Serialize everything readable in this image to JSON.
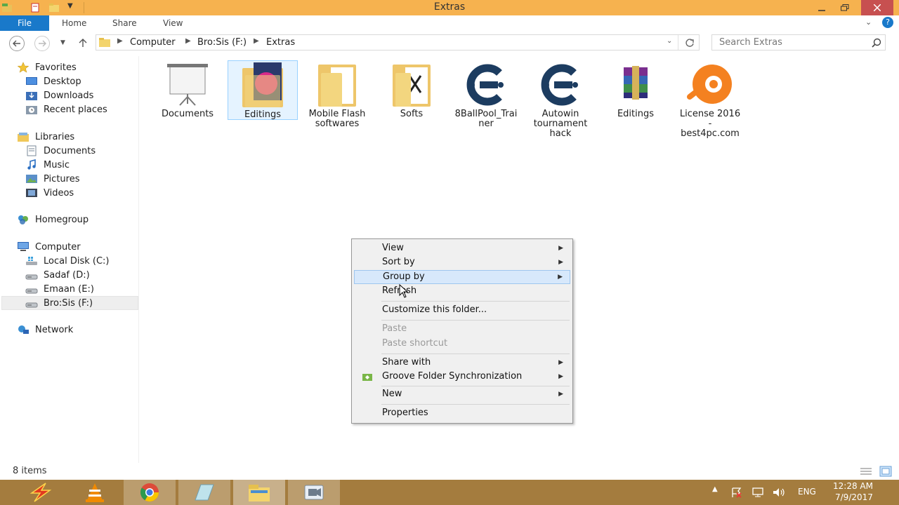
{
  "window": {
    "title": "Extras"
  },
  "ribbon": {
    "tabs": [
      "File",
      "Home",
      "Share",
      "View"
    ]
  },
  "address": {
    "crumbs": [
      "Computer",
      "Bro:Sis (F:)",
      "Extras"
    ]
  },
  "search": {
    "placeholder": "Search Extras"
  },
  "nav": {
    "favorites": {
      "label": "Favorites",
      "items": [
        "Desktop",
        "Downloads",
        "Recent places"
      ]
    },
    "libraries": {
      "label": "Libraries",
      "items": [
        "Documents",
        "Music",
        "Pictures",
        "Videos"
      ]
    },
    "homegroup": "Homegroup",
    "computer": {
      "label": "Computer",
      "items": [
        "Local Disk (C:)",
        "Sadaf (D:)",
        "Emaan (E:)",
        "Bro:Sis (F:)"
      ]
    },
    "network": "Network"
  },
  "files": [
    {
      "name": "Documents",
      "icon": "presentation-icon"
    },
    {
      "name": "Editings",
      "icon": "folder-icon",
      "selected": true
    },
    {
      "name": "Mobile Flash softwares",
      "icon": "folder-icon"
    },
    {
      "name": "Softs",
      "icon": "folder-icon"
    },
    {
      "name": "8BallPool_Trainer",
      "icon": "cheat-engine-icon"
    },
    {
      "name": "Autowin tournament hack",
      "icon": "cheat-engine-icon"
    },
    {
      "name": "Editings",
      "icon": "winrar-icon"
    },
    {
      "name": "License 2016 - best4pc.com",
      "icon": "avast-icon"
    }
  ],
  "context_menu": {
    "items": [
      {
        "label": "View",
        "submenu": true
      },
      {
        "label": "Sort by",
        "submenu": true
      },
      {
        "label": "Group by",
        "submenu": true,
        "highlighted": true
      },
      {
        "label": "Refresh"
      },
      {
        "label": "Customize this folder..."
      },
      {
        "label": "Paste",
        "disabled": true
      },
      {
        "label": "Paste shortcut",
        "disabled": true
      },
      {
        "label": "Share with",
        "submenu": true
      },
      {
        "label": "Groove Folder Synchronization",
        "submenu": true
      },
      {
        "label": "New",
        "submenu": true
      },
      {
        "label": "Properties"
      }
    ]
  },
  "status": {
    "item_count": "8 items"
  },
  "tray": {
    "language": "ENG",
    "time": "12:28 AM",
    "date": "7/9/2017"
  },
  "colors": {
    "titlebar": "#f6b24f",
    "taskbar": "#a47c3e",
    "file_tab": "#1979ca"
  }
}
